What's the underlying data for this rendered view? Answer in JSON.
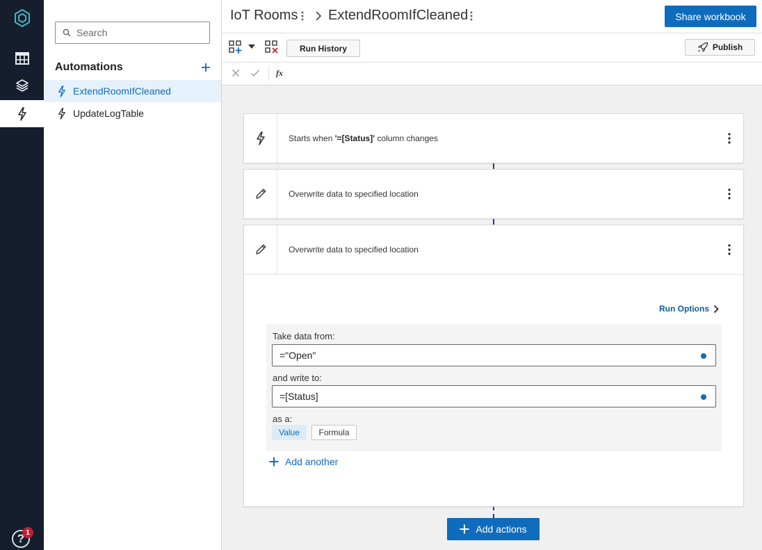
{
  "rail": {
    "items": [
      {
        "icon": "table-icon"
      },
      {
        "icon": "layers-icon"
      },
      {
        "icon": "lightning-icon"
      }
    ],
    "help_badge": "1"
  },
  "sidebar": {
    "search_placeholder": "Search",
    "section_title": "Automations",
    "items": [
      {
        "label": "ExtendRoomIfCleaned",
        "active": true
      },
      {
        "label": "UpdateLogTable",
        "active": false
      }
    ]
  },
  "header": {
    "breadcrumb_root": "IoT Rooms",
    "breadcrumb_current": "ExtendRoomIfCleaned",
    "share_label": "Share workbook"
  },
  "toolbar": {
    "run_history_label": "Run History",
    "publish_label": "Publish"
  },
  "formula_bar": {
    "fx_label": "fx"
  },
  "flow": {
    "trigger": {
      "prefix": "Starts when ",
      "column": "'=[Status]'",
      "suffix": " column changes"
    },
    "step1_label": "Overwrite data to specified location",
    "step2_label": "Overwrite data to specified location",
    "run_options_label": "Run Options",
    "take_data_label": "Take data from:",
    "take_data_value": "=\"Open\"",
    "write_to_label": "and write to:",
    "write_to_value": "=[Status]",
    "as_a_label": "as a:",
    "option_value": "Value",
    "option_formula": "Formula",
    "add_another_label": "Add another",
    "add_actions_label": "Add actions"
  },
  "colors": {
    "accent": "#0f6cbd",
    "rail_bg": "#161d2d",
    "active_item_bg": "#e6f2fb",
    "badge": "#c21f32"
  }
}
